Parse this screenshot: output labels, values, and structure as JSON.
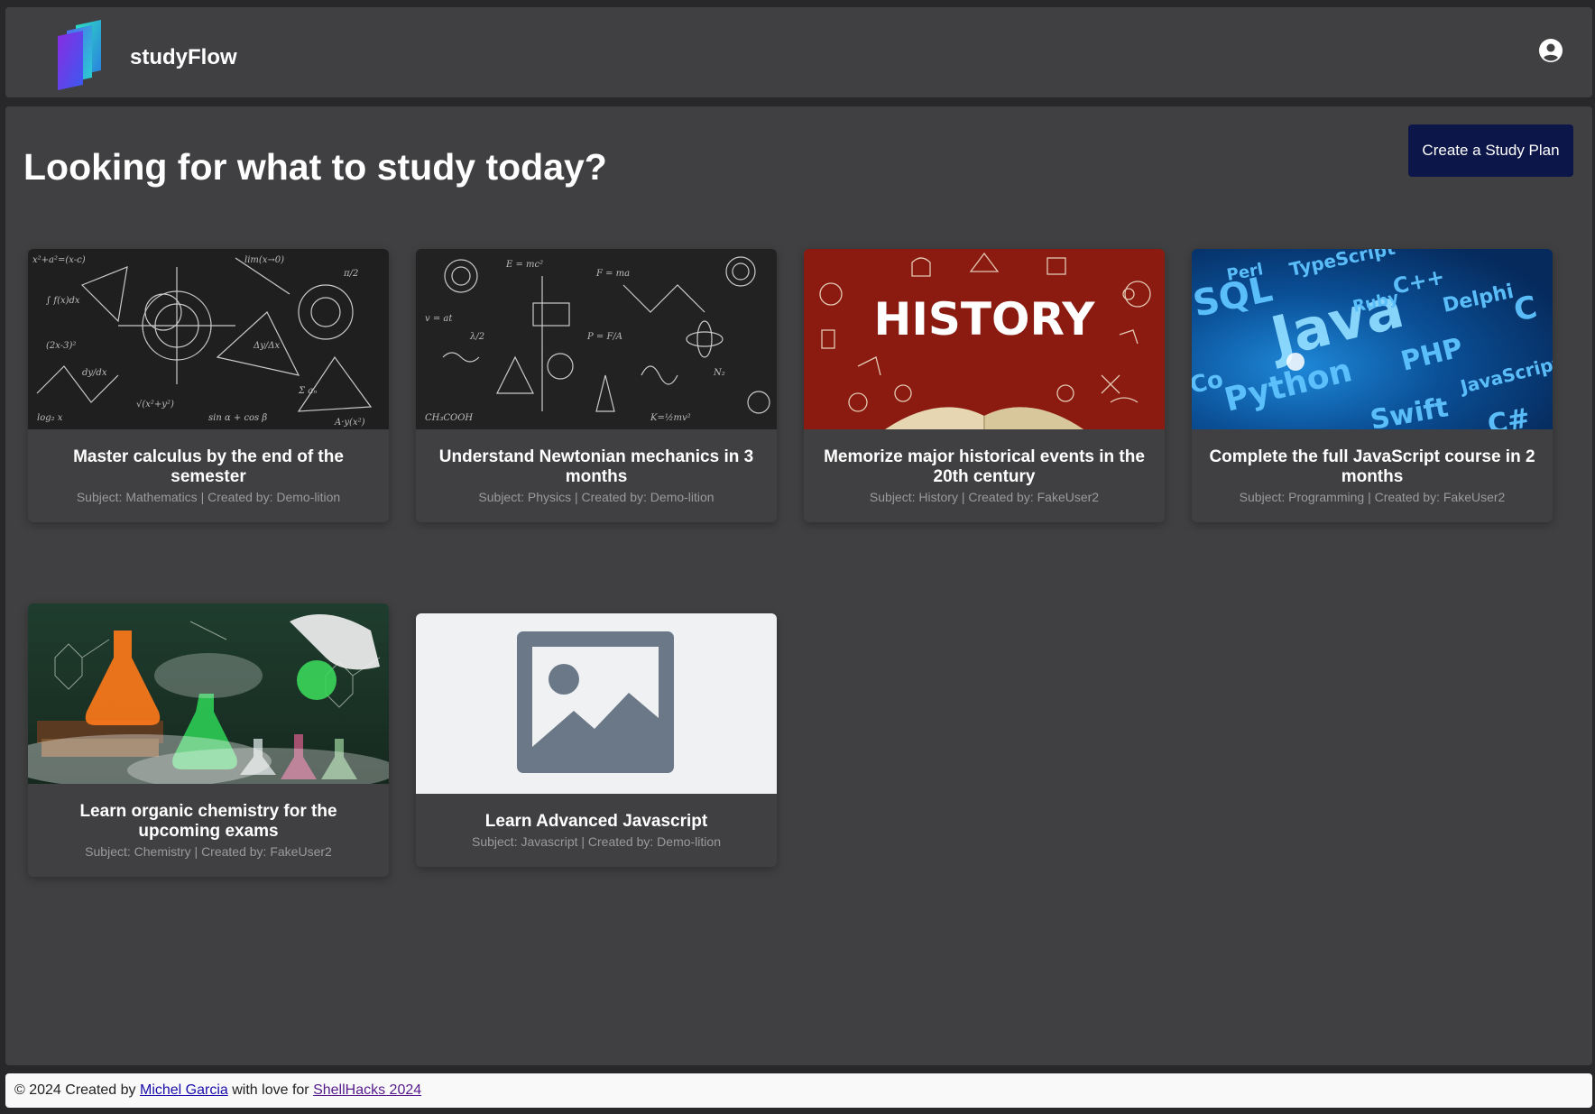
{
  "app": {
    "name": "studyFlow"
  },
  "page": {
    "title": "Looking for what to study today?",
    "create_button": "Create a Study Plan"
  },
  "cards": [
    {
      "title": "Master calculus by the end of the semester",
      "meta": "Subject: Mathematics | Created by: Demo-lition",
      "image": "chalkboard-math-formulas"
    },
    {
      "title": "Understand Newtonian mechanics in 3 months",
      "meta": "Subject: Physics | Created by: Demo-lition",
      "image": "chalkboard-science-doodles"
    },
    {
      "title": "Memorize major historical events in the 20th century",
      "meta": "Subject: History | Created by: FakeUser2",
      "image": "history-banner-book"
    },
    {
      "title": "Complete the full JavaScript course in 2 months",
      "meta": "Subject: Programming | Created by: FakeUser2",
      "image": "programming-languages-blue",
      "banner": {
        "sql": "SQL",
        "java": "Java",
        "python": "Python",
        "php": "PHP",
        "perl": "Perl",
        "typescript": "TypeScript",
        "cpp": "C++",
        "ruby": "Ruby",
        "delphi": "Delphi",
        "c": "C",
        "javascript": "JavaScript",
        "swift": "Swift",
        "csharp": "C#",
        "co": "Co"
      }
    },
    {
      "title": "Learn organic chemistry for the upcoming exams",
      "meta": "Subject: Chemistry | Created by: FakeUser2",
      "image": "chemistry-flasks-smoke"
    },
    {
      "title": "Learn Advanced Javascript",
      "meta": "Subject: Javascript | Created by: Demo-lition",
      "image": "image-placeholder"
    }
  ],
  "history_banner": "HISTORY",
  "footer": {
    "prefix": "© 2024 Created by ",
    "author": "Michel Garcia",
    "middle": " with love for ",
    "event": "ShellHacks 2024"
  },
  "colors": {
    "background": "#28282a",
    "panel": "#404042",
    "primary_button": "#0c1648",
    "text": "#ffffff",
    "muted_text": "#9a9a9c"
  },
  "icons": {
    "logo": "book-logo-icon",
    "user": "user-circle-icon",
    "placeholder": "image-placeholder-icon"
  }
}
